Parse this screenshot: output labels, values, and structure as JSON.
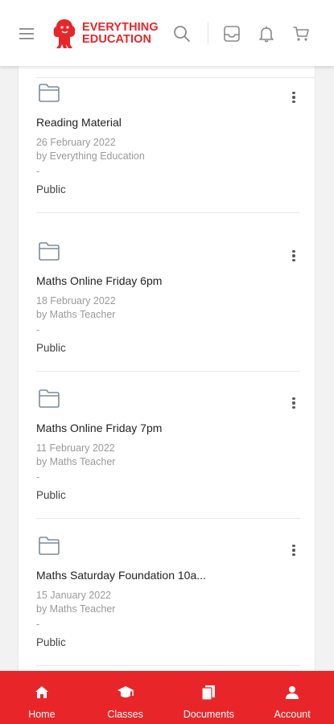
{
  "header": {
    "brand_line1": "EVERYTHING",
    "brand_line2": "EDUCATION",
    "icons": [
      "hamburger-menu-icon",
      "search-icon",
      "inbox-icon",
      "bell-icon",
      "cart-icon"
    ]
  },
  "documents": [
    {
      "title": "Reading Material",
      "date": "26 February 2022",
      "author": "by Everything Education",
      "dash": "-",
      "visibility": "Public"
    },
    {
      "title": "Maths Online Friday 6pm",
      "date": "18 February 2022",
      "author": "by Maths Teacher",
      "dash": "-",
      "visibility": "Public"
    },
    {
      "title": "Maths Online Friday 7pm",
      "date": "11 February 2022",
      "author": "by Maths Teacher",
      "dash": "-",
      "visibility": "Public"
    },
    {
      "title": "Maths Saturday Foundation 10a...",
      "date": "15 January 2022",
      "author": "by Maths Teacher",
      "dash": "-",
      "visibility": "Public"
    }
  ],
  "bottom_nav": [
    {
      "label": "Home",
      "icon": "home-icon"
    },
    {
      "label": "Classes",
      "icon": "graduation-cap-icon"
    },
    {
      "label": "Documents",
      "icon": "documents-icon"
    },
    {
      "label": "Account",
      "icon": "account-icon"
    }
  ],
  "colors": {
    "brand": "#e8262a",
    "background": "#f2f2f2",
    "card": "#ffffff"
  }
}
